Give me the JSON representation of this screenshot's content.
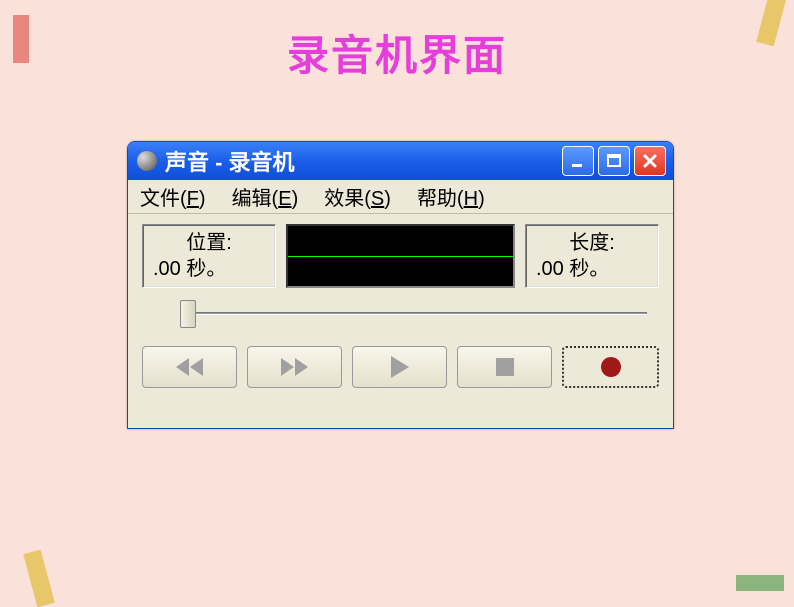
{
  "page": {
    "title": "录音机界面"
  },
  "window": {
    "title": "声音 - 录音机"
  },
  "menu": {
    "file": "文件(",
    "file_key": "F",
    "file_close": ")",
    "edit": "编辑(",
    "edit_key": "E",
    "edit_close": ")",
    "effects": "效果(",
    "effects_key": "S",
    "effects_close": ")",
    "help": "帮助(",
    "help_key": "H",
    "help_close": ")"
  },
  "display": {
    "position_label": "位置:",
    "position_value": ".00 秒。",
    "length_label": "长度:",
    "length_value": ".00 秒。"
  },
  "icons": {
    "minimize": "minimize",
    "maximize": "maximize",
    "close": "close"
  }
}
